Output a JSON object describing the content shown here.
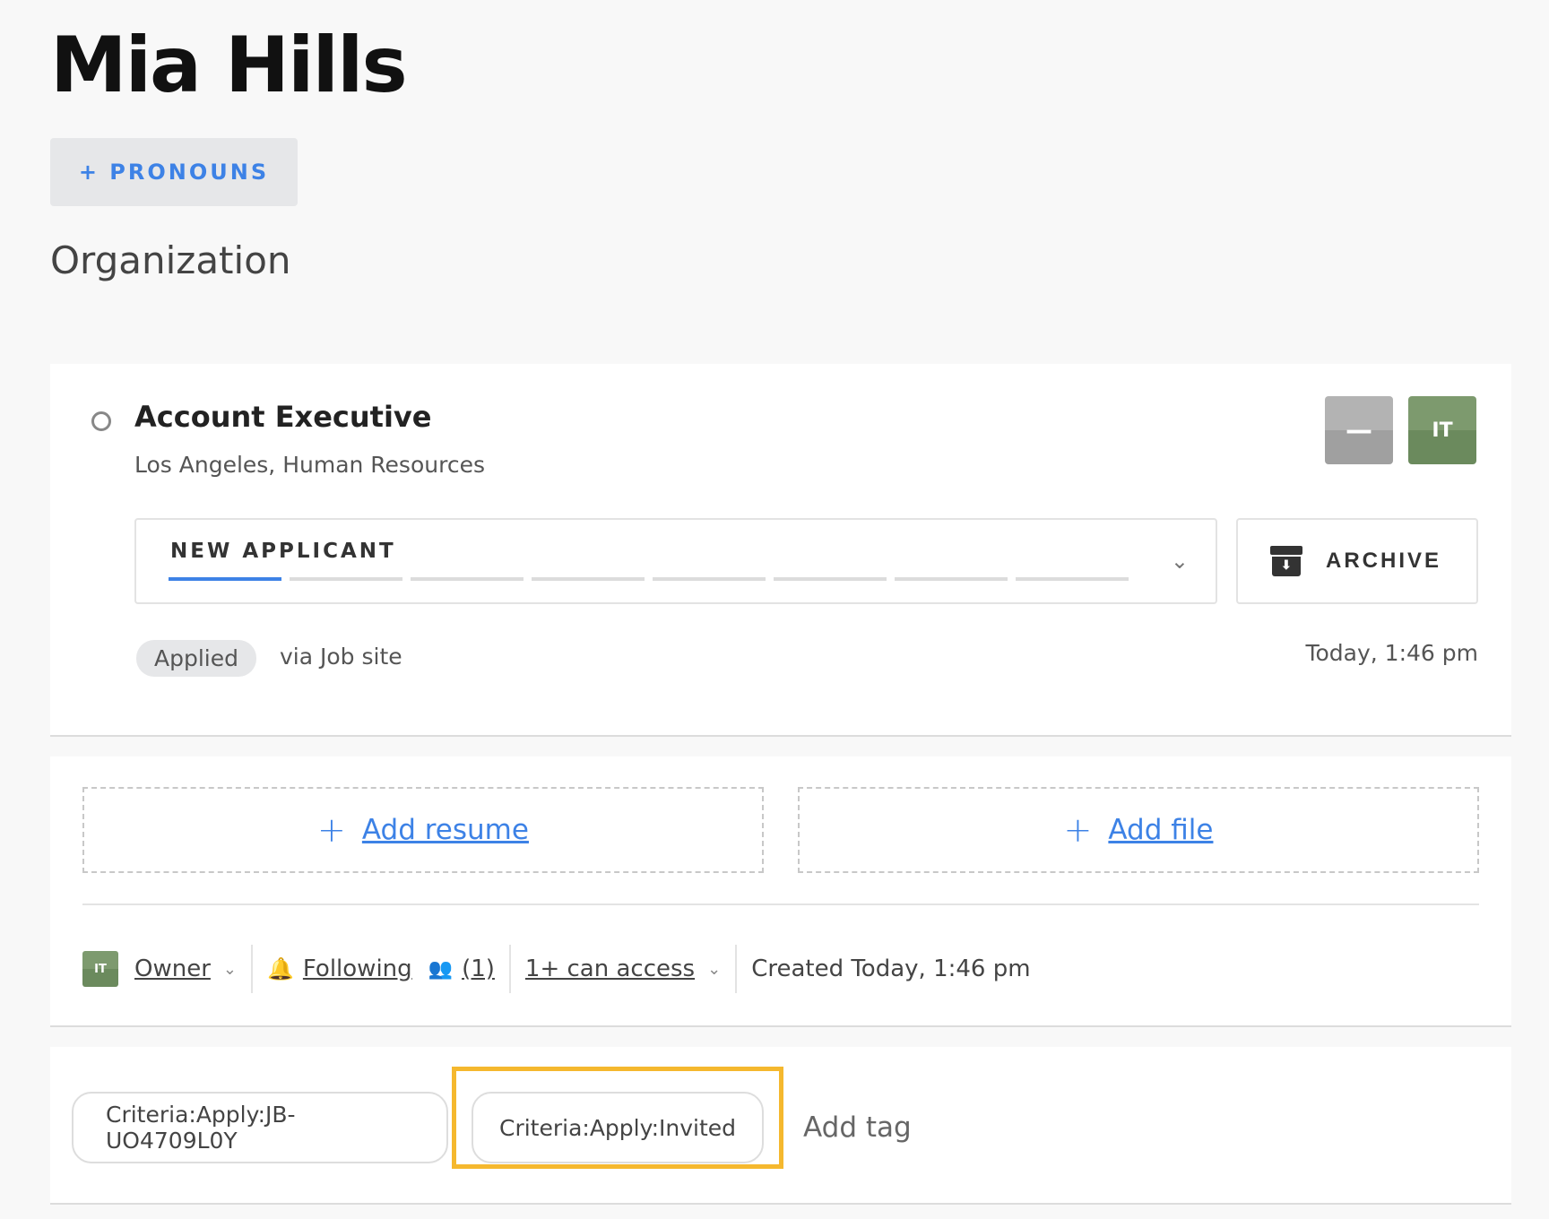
{
  "profile": {
    "name": "Mia Hills",
    "pronouns_button": "+ PRONOUNS",
    "organization": "Organization"
  },
  "opportunity": {
    "title": "Account Executive",
    "location": "Los Angeles, Human Resources",
    "avatars": [
      "—",
      "IT"
    ],
    "stage": {
      "label": "NEW APPLICANT",
      "segments": 8,
      "active_index": 0
    },
    "archive_label": "ARCHIVE",
    "applied_badge": "Applied",
    "source": "via Job site",
    "timestamp": "Today, 1:46 pm"
  },
  "files": {
    "add_resume": "Add resume",
    "add_file": "Add file"
  },
  "meta": {
    "owner_avatar": "IT",
    "owner_label": "Owner",
    "following_label": "Following",
    "followers_count": "(1)",
    "access_label": "1+ can access",
    "created": "Created Today, 1:46 pm"
  },
  "tags": {
    "items": [
      "Criteria:Apply:JB-UO4709L0Y",
      "Criteria:Apply:Invited"
    ],
    "add_placeholder": "Add tag"
  },
  "colors": {
    "accent": "#3d82e6",
    "highlight": "#f5b82e",
    "avatar_green": "#7d9a6e"
  }
}
